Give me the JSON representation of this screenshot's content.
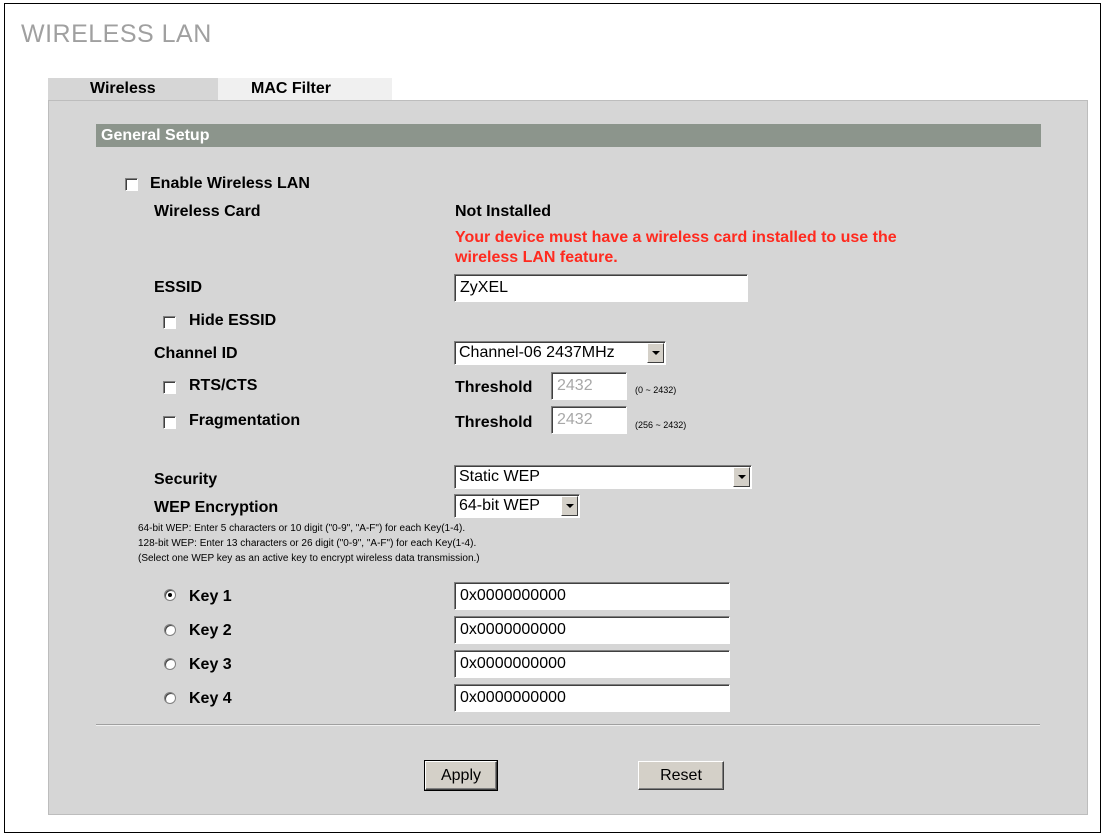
{
  "page": {
    "title": "WIRELESS LAN"
  },
  "tabs": [
    {
      "label": "Wireless",
      "active": true
    },
    {
      "label": "MAC Filter",
      "active": false
    }
  ],
  "section": {
    "title": "General Setup"
  },
  "form": {
    "enable_wireless": {
      "label": "Enable Wireless LAN",
      "checked": false
    },
    "wireless_card": {
      "label": "Wireless Card",
      "value": "Not Installed",
      "warning_line1": "Your device must have a wireless card installed to use the",
      "warning_line2": "wireless LAN feature."
    },
    "essid": {
      "label": "ESSID",
      "value": "ZyXEL"
    },
    "hide_essid": {
      "label": "Hide ESSID",
      "checked": false
    },
    "channel_id": {
      "label": "Channel ID",
      "value": "Channel-06 2437MHz"
    },
    "rts_cts": {
      "label": "RTS/CTS",
      "checked": false,
      "threshold_label": "Threshold",
      "threshold_value": "2432",
      "range": "(0 ~ 2432)"
    },
    "fragmentation": {
      "label": "Fragmentation",
      "checked": false,
      "threshold_label": "Threshold",
      "threshold_value": "2432",
      "range": "(256 ~ 2432)"
    },
    "security": {
      "label": "Security",
      "value": "Static WEP"
    },
    "wep_encryption": {
      "label": "WEP Encryption",
      "value": "64-bit WEP",
      "notes": [
        "64-bit WEP: Enter 5 characters or 10 digit (\"0-9\", \"A-F\") for each Key(1-4).",
        "128-bit WEP: Enter 13 characters or 26 digit (\"0-9\", \"A-F\") for each Key(1-4).",
        "(Select one WEP key as an active key to encrypt wireless data transmission.)"
      ]
    },
    "keys": [
      {
        "label": "Key 1",
        "value": "0x0000000000",
        "selected": true
      },
      {
        "label": "Key 2",
        "value": "0x0000000000",
        "selected": false
      },
      {
        "label": "Key 3",
        "value": "0x0000000000",
        "selected": false
      },
      {
        "label": "Key 4",
        "value": "0x0000000000",
        "selected": false
      }
    ]
  },
  "buttons": {
    "apply": "Apply",
    "reset": "Reset"
  }
}
